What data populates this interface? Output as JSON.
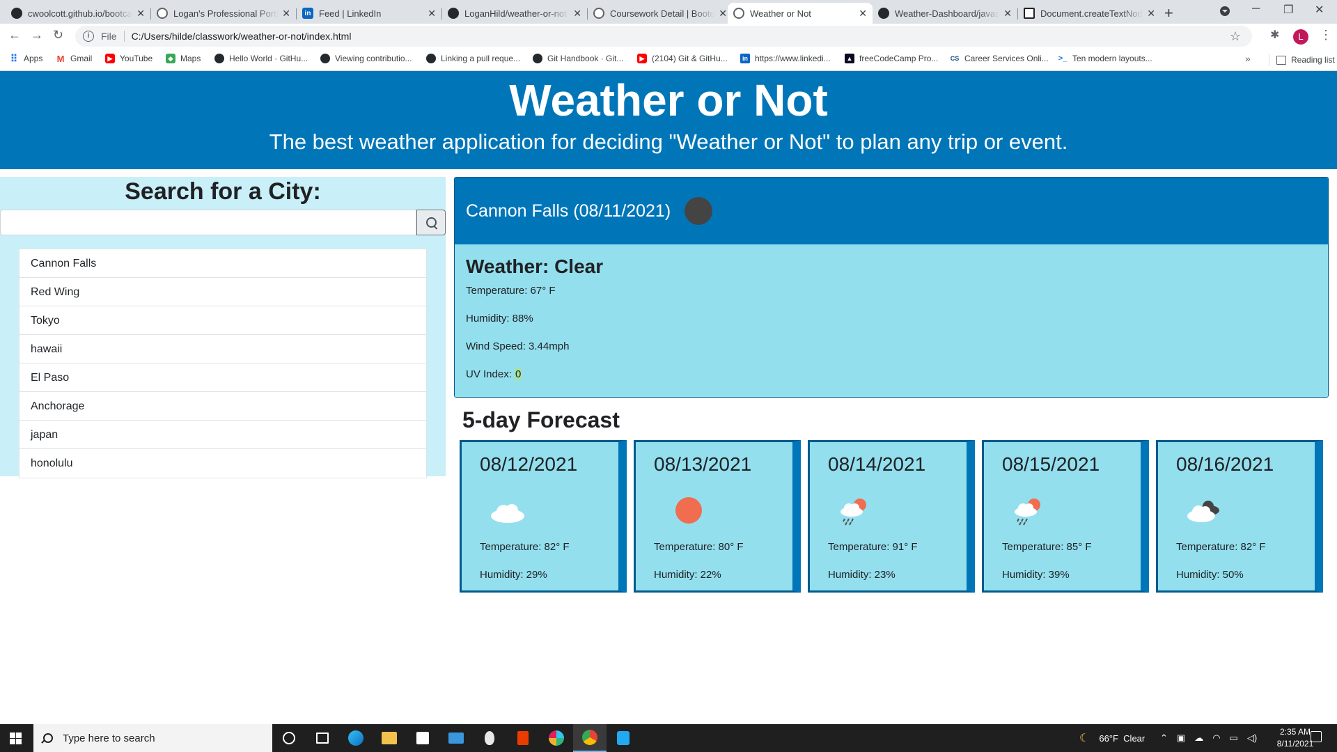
{
  "browser": {
    "tabs": [
      {
        "title": "cwoolcott.github.io/bootca",
        "favicon": "github-icon"
      },
      {
        "title": "Logan's Professional Portfo",
        "favicon": "globe-icon"
      },
      {
        "title": "Feed | LinkedIn",
        "favicon": "linkedin-icon"
      },
      {
        "title": "LoganHild/weather-or-not",
        "favicon": "github-icon"
      },
      {
        "title": "Coursework Detail | Bootca",
        "favicon": "globe-icon"
      },
      {
        "title": "Weather or Not",
        "favicon": "globe-icon",
        "active": true
      },
      {
        "title": "Weather-Dashboard/javas",
        "favicon": "github-icon"
      },
      {
        "title": "Document.createTextNode",
        "favicon": "document-icon"
      }
    ],
    "new_tab": "+",
    "address": {
      "scheme_label": "File",
      "url": "C:/Users/hilde/classwork/weather-or-not/index.html"
    },
    "profile_initial": "L",
    "bookmarks": [
      {
        "label": "Apps",
        "icon": "apps-icon"
      },
      {
        "label": "Gmail",
        "icon": "gmail-icon"
      },
      {
        "label": "YouTube",
        "icon": "youtube-icon"
      },
      {
        "label": "Maps",
        "icon": "maps-icon"
      },
      {
        "label": "Hello World · GitHu...",
        "icon": "github-icon"
      },
      {
        "label": "Viewing contributio...",
        "icon": "github-icon"
      },
      {
        "label": "Linking a pull reque...",
        "icon": "github-icon"
      },
      {
        "label": "Git Handbook · Git...",
        "icon": "github-icon"
      },
      {
        "label": "(2104) Git & GitHu...",
        "icon": "youtube-icon"
      },
      {
        "label": "https://www.linkedi...",
        "icon": "linkedin-icon"
      },
      {
        "label": "freeCodeCamp Pro...",
        "icon": "freecodecamp-icon"
      },
      {
        "label": "Career Services Onli...",
        "icon": "career-services-icon"
      },
      {
        "label": "Ten modern layouts...",
        "icon": "terminal-icon"
      }
    ],
    "more_bookmarks": "»",
    "reading_list": "Reading list"
  },
  "page": {
    "title": "Weather or Not",
    "tagline": "The best weather application for deciding \"Weather or Not\" to plan any trip or event.",
    "search": {
      "heading": "Search for a City:",
      "input_value": "",
      "input_placeholder": ""
    },
    "history": [
      "Cannon Falls",
      "Red Wing",
      "Tokyo",
      "hawaii",
      "El Paso",
      "Anchorage",
      "japan",
      "honolulu"
    ],
    "current": {
      "city_date": "Cannon Falls (08/11/2021)",
      "icon": "moon-icon",
      "weather": "Weather: Clear",
      "temperature_label": "Temperature: 67° F",
      "humidity_label": "Humidity: 88%",
      "wind_label": "Wind Speed: 3.44mph",
      "uv_label": "UV Index: ",
      "uv_value": "0",
      "colors": {
        "header": "#0076b9",
        "body": "#93dfee",
        "uv_good": "#a6e3a1"
      }
    },
    "forecast_heading": "5-day Forecast",
    "forecast": [
      {
        "date": "08/12/2021",
        "icon": "cloud-icon",
        "temperature": "Temperature: 82° F",
        "humidity": "Humidity: 29%"
      },
      {
        "date": "08/13/2021",
        "icon": "sun-icon",
        "temperature": "Temperature: 80° F",
        "humidity": "Humidity: 22%"
      },
      {
        "date": "08/14/2021",
        "icon": "sun-rain-icon",
        "temperature": "Temperature: 91° F",
        "humidity": "Humidity: 23%"
      },
      {
        "date": "08/15/2021",
        "icon": "sun-rain-icon",
        "temperature": "Temperature: 85° F",
        "humidity": "Humidity: 39%"
      },
      {
        "date": "08/16/2021",
        "icon": "dark-cloud-icon",
        "temperature": "Temperature: 82° F",
        "humidity": "Humidity: 50%"
      }
    ]
  },
  "taskbar": {
    "search_placeholder": "Type here to search",
    "apps": [
      "cortana-icon",
      "task-view-icon",
      "edge-icon",
      "file-explorer-icon",
      "store-icon",
      "mail-icon",
      "alien-icon",
      "office-icon",
      "slack-icon",
      "chrome-icon",
      "vscode-icon"
    ],
    "weather": "66°F  Clear",
    "time": "2:35 AM",
    "date": "8/11/2021"
  }
}
